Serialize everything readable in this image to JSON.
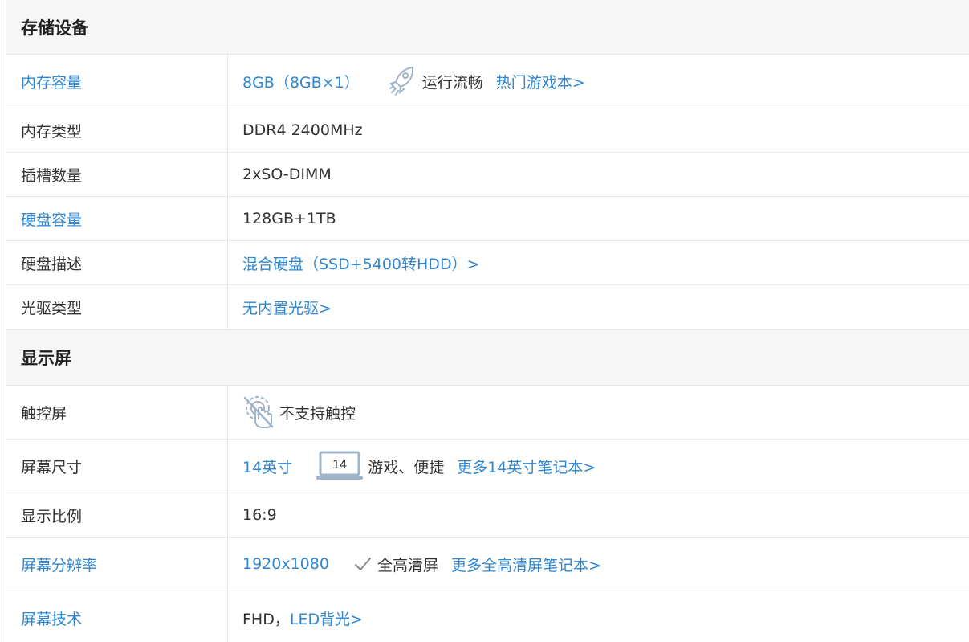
{
  "storage": {
    "title": "存储设备",
    "memory_capacity": {
      "label": "内存容量",
      "value": "8GB（8GB×1）",
      "feature": "运行流畅",
      "link": "热门游戏本>"
    },
    "memory_type": {
      "label": "内存类型",
      "value": "DDR4 2400MHz"
    },
    "slots": {
      "label": "插槽数量",
      "value": "2xSO-DIMM"
    },
    "disk_capacity": {
      "label": "硬盘容量",
      "value": "128GB+1TB"
    },
    "disk_desc": {
      "label": "硬盘描述",
      "value": "混合硬盘（SSD+5400转HDD）>"
    },
    "optical": {
      "label": "光驱类型",
      "value": "无内置光驱>"
    }
  },
  "display": {
    "title": "显示屏",
    "touch": {
      "label": "触控屏",
      "value": "不支持触控"
    },
    "screen_size": {
      "label": "屏幕尺寸",
      "value": "14英寸",
      "badge": "14",
      "feature": "游戏、便捷",
      "link": "更多14英寸笔记本>"
    },
    "aspect_ratio": {
      "label": "显示比例",
      "value": "16:9"
    },
    "resolution": {
      "label": "屏幕分辨率",
      "value": "1920x1080",
      "feature": "全高清屏",
      "link": "更多全高清屏笔记本>"
    },
    "tech": {
      "label": "屏幕技术",
      "prefix": "FHD，",
      "link": "LED背光>"
    }
  },
  "colors": {
    "link": "#2f86d2",
    "text": "#333333",
    "header_bg": "#f6f6f6",
    "border": "#e8e8e8",
    "icon": "#9fb4c8"
  },
  "icons": [
    "rocket-icon",
    "touch-disabled-icon",
    "laptop-icon",
    "check-icon"
  ]
}
